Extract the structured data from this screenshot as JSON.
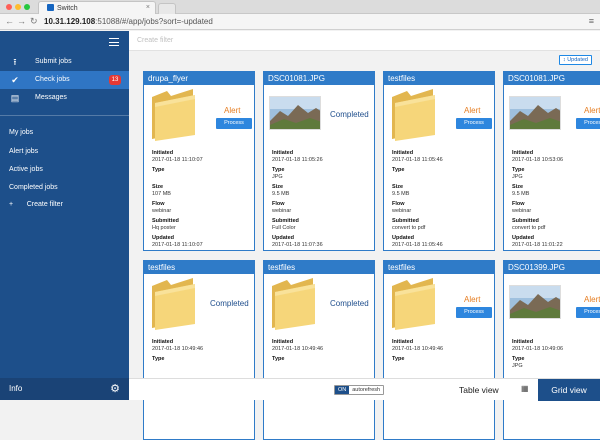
{
  "browser": {
    "tab_title": "Switch",
    "tab_close": "×",
    "url_host": "10.31.129.108",
    "url_rest": ":51088/#/app/jobs?sort=-updated"
  },
  "sidebar": {
    "items": [
      {
        "label": "Submit jobs",
        "icon": "upload-icon"
      },
      {
        "label": "Check jobs",
        "icon": "check-circle-icon",
        "badge": "13"
      },
      {
        "label": "Messages",
        "icon": "list-icon"
      }
    ],
    "links": [
      "My jobs",
      "Alert jobs",
      "Active jobs",
      "Completed jobs"
    ],
    "create_filter": "Create filter",
    "footer": "Info"
  },
  "main": {
    "filter_placeholder": "Create filter",
    "sort_label": "↕ Updated",
    "cards": [
      {
        "title": "drupa_flyer",
        "thumb": "folder",
        "status": "Alert",
        "has_process": true,
        "process_label": "Process",
        "meta": [
          {
            "k": "Initiated",
            "v": "2017-01-18 11:10:07"
          },
          {
            "k": "Type",
            "v": ""
          },
          {
            "k": "Size",
            "v": "107 MB"
          },
          {
            "k": "Flow",
            "v": "webinar"
          },
          {
            "k": "Submitted",
            "v": "Hq poster"
          },
          {
            "k": "Updated",
            "v": "2017-01-18 11:10:07"
          }
        ]
      },
      {
        "title": "DSC01081.JPG",
        "thumb": "photo",
        "status": "Completed",
        "has_process": false,
        "meta": [
          {
            "k": "Initiated",
            "v": "2017-01-18 11:05:26"
          },
          {
            "k": "Type",
            "v": "JPG"
          },
          {
            "k": "Size",
            "v": "9.5 MB"
          },
          {
            "k": "Flow",
            "v": "webinar"
          },
          {
            "k": "Submitted",
            "v": "Full Color"
          },
          {
            "k": "Updated",
            "v": "2017-01-18 11:07:36"
          }
        ]
      },
      {
        "title": "testfiles",
        "thumb": "folder",
        "status": "Alert",
        "has_process": true,
        "process_label": "Process",
        "meta": [
          {
            "k": "Initiated",
            "v": "2017-01-18 11:05:46"
          },
          {
            "k": "Type",
            "v": ""
          },
          {
            "k": "Size",
            "v": "9.5 MB"
          },
          {
            "k": "Flow",
            "v": "webinar"
          },
          {
            "k": "Submitted",
            "v": "convert to pdf"
          },
          {
            "k": "Updated",
            "v": "2017-01-18 11:05:46"
          }
        ]
      },
      {
        "title": "DSC01081.JPG",
        "thumb": "photo",
        "status": "Alert",
        "has_process": true,
        "process_label": "Process",
        "meta": [
          {
            "k": "Initiated",
            "v": "2017-01-18 10:53:06"
          },
          {
            "k": "Type",
            "v": "JPG"
          },
          {
            "k": "Size",
            "v": "9.5 MB"
          },
          {
            "k": "Flow",
            "v": "webinar"
          },
          {
            "k": "Submitted",
            "v": "convert to pdf"
          },
          {
            "k": "Updated",
            "v": "2017-01-18 11:01:22"
          }
        ]
      },
      {
        "title": "testfiles",
        "thumb": "folder",
        "status": "Completed",
        "has_process": false,
        "meta": [
          {
            "k": "Initiated",
            "v": "2017-01-18 10:49:46"
          },
          {
            "k": "Type",
            "v": ""
          }
        ]
      },
      {
        "title": "testfiles",
        "thumb": "folder",
        "status": "Completed",
        "has_process": false,
        "meta": [
          {
            "k": "Initiated",
            "v": "2017-01-18 10:49:46"
          },
          {
            "k": "Type",
            "v": ""
          }
        ]
      },
      {
        "title": "testfiles",
        "thumb": "folder",
        "status": "Alert",
        "has_process": true,
        "process_label": "Process",
        "meta": [
          {
            "k": "Initiated",
            "v": "2017-01-18 10:49:46"
          },
          {
            "k": "Type",
            "v": ""
          }
        ]
      },
      {
        "title": "DSC01399.JPG",
        "thumb": "photo",
        "status": "Alert",
        "has_process": true,
        "process_label": "Process",
        "meta": [
          {
            "k": "Initiated",
            "v": "2017-01-18 10:49:06"
          },
          {
            "k": "Type",
            "v": "JPG"
          }
        ]
      }
    ]
  },
  "bottom": {
    "toggle_on": "ON",
    "toggle_label": "autorefresh",
    "table_view": "Table view",
    "grid_view": "Grid view"
  },
  "colors": {
    "sidebar": "#1d4f8a",
    "accent": "#2f7bc8",
    "alert": "#e67e22",
    "completed": "#1f4e8c",
    "badge": "#e53935"
  }
}
